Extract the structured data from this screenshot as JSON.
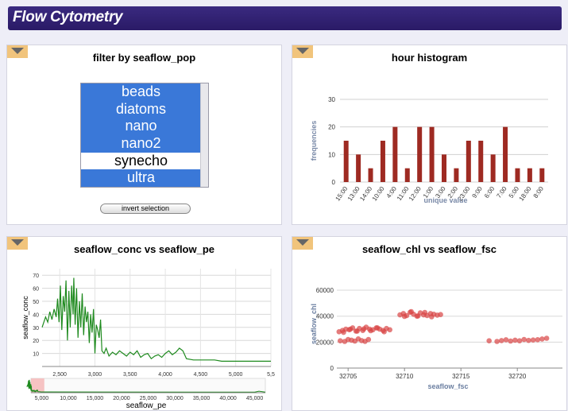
{
  "app": {
    "title": "Flow Cytometry"
  },
  "filter_panel": {
    "title": "filter by seaflow_pop",
    "options": [
      {
        "label": "beads",
        "selected": true
      },
      {
        "label": "diatoms",
        "selected": true
      },
      {
        "label": "nano",
        "selected": true
      },
      {
        "label": "nano2",
        "selected": true
      },
      {
        "label": "synecho",
        "selected": false
      },
      {
        "label": "ultra",
        "selected": true
      }
    ],
    "invert_label": "invert selection",
    "selected_color": "#3a78d8"
  },
  "histogram_panel": {
    "title": "hour histogram"
  },
  "conc_panel": {
    "title": "seaflow_conc vs seaflow_pe"
  },
  "chl_panel": {
    "title": "seaflow_chl vs seaflow_fsc"
  },
  "icons": {
    "collapse": "triangle-down-icon"
  },
  "chart_data": [
    {
      "type": "bar",
      "title": "hour histogram",
      "xlabel": "unique value",
      "ylabel": "frequencies",
      "ylim": [
        0,
        30
      ],
      "yticks": [
        0,
        10,
        20,
        30
      ],
      "categories": [
        "15:00",
        "13:00",
        "14:00",
        "10:00",
        "4:00",
        "11:00",
        "12:00",
        "1:00",
        "3:00",
        "2:00",
        "23:00",
        "9:00",
        "6:00",
        "7:00",
        "5:00",
        "18:00",
        "8:00"
      ],
      "values": [
        15,
        10,
        5,
        15,
        20,
        5,
        20,
        20,
        10,
        5,
        15,
        15,
        10,
        20,
        5,
        5,
        5
      ],
      "color": "#9e2a22",
      "grid": true
    },
    {
      "type": "line",
      "title": "seaflow_conc vs seaflow_pe",
      "xlabel": "",
      "ylabel": "seaflow_conc",
      "xlim": [
        2250,
        5500
      ],
      "ylim": [
        0,
        75
      ],
      "xticks": [
        2500,
        3000,
        3500,
        4000,
        4500,
        5000,
        5500
      ],
      "xtick_labels": [
        "2,500",
        "3,000",
        "3,500",
        "4,000",
        "4,500",
        "5,000",
        "5,5"
      ],
      "yticks": [
        10,
        20,
        30,
        40,
        50,
        60,
        70
      ],
      "color": "#1e8a1e",
      "x": [
        2250,
        2300,
        2330,
        2360,
        2390,
        2420,
        2450,
        2470,
        2490,
        2510,
        2530,
        2550,
        2570,
        2590,
        2610,
        2630,
        2650,
        2670,
        2690,
        2700,
        2720,
        2740,
        2760,
        2780,
        2800,
        2820,
        2840,
        2860,
        2880,
        2900,
        2920,
        2940,
        2960,
        2980,
        3000,
        3020,
        3040,
        3060,
        3080,
        3100,
        3130,
        3160,
        3200,
        3250,
        3300,
        3350,
        3400,
        3450,
        3500,
        3550,
        3600,
        3650,
        3700,
        3750,
        3800,
        3850,
        3900,
        3950,
        4000,
        4050,
        4100,
        4150,
        4200,
        4250,
        4300,
        4400,
        4500,
        4600,
        4700,
        4800,
        5000,
        5200,
        5500
      ],
      "y": [
        30,
        38,
        34,
        42,
        36,
        44,
        38,
        52,
        34,
        62,
        28,
        54,
        42,
        66,
        20,
        58,
        30,
        62,
        40,
        68,
        32,
        60,
        22,
        50,
        30,
        56,
        24,
        46,
        34,
        42,
        18,
        40,
        26,
        44,
        10,
        32,
        28,
        22,
        36,
        12,
        10,
        14,
        8,
        11,
        9,
        12,
        10,
        8,
        11,
        9,
        12,
        7,
        9,
        10,
        6,
        8,
        9,
        7,
        10,
        12,
        9,
        11,
        14,
        12,
        6,
        5,
        5,
        5,
        5,
        4,
        4,
        4,
        4
      ],
      "navigator": {
        "xticks": [
          5000,
          10000,
          15000,
          20000,
          25000,
          30000,
          35000,
          40000,
          45000
        ],
        "xtick_labels": [
          "5,000",
          "10,000",
          "15,000",
          "20,000",
          "25,000",
          "30,000",
          "35,000",
          "40,000",
          "45,000"
        ],
        "xlabel": "seaflow_pe",
        "xlim": [
          3000,
          47000
        ],
        "selection": [
          3000,
          5500
        ]
      },
      "grid": true
    },
    {
      "type": "scatter",
      "title": "seaflow_chl vs seaflow_fsc",
      "xlabel": "seaflow_fsc",
      "ylabel": "seaflow_chl",
      "xlim": [
        32704,
        32724
      ],
      "ylim": [
        0,
        68000
      ],
      "xticks": [
        32705,
        32710,
        32715,
        32720
      ],
      "yticks": [
        0,
        20000,
        40000,
        60000
      ],
      "color": "#d94545",
      "x": [
        32704.2,
        32704.5,
        32704.8,
        32705.1,
        32705.4,
        32705.7,
        32706.0,
        32706.3,
        32706.6,
        32706.9,
        32707.2,
        32707.5,
        32707.8,
        32708.1,
        32708.4,
        32708.7,
        32704.3,
        32704.7,
        32705.0,
        32705.3,
        32705.6,
        32705.9,
        32706.2,
        32706.5,
        32706.8,
        32704.6,
        32705.2,
        32705.8,
        32706.4,
        32707.0,
        32707.6,
        32708.2,
        32709.6,
        32709.9,
        32710.2,
        32710.5,
        32710.8,
        32711.1,
        32711.4,
        32711.7,
        32712.0,
        32712.3,
        32712.6,
        32712.9,
        32713.2,
        32710.0,
        32710.6,
        32711.2,
        32711.8,
        32712.4,
        32717.5,
        32718.2,
        32718.6,
        32719.0,
        32719.4,
        32719.8,
        32720.2,
        32720.6,
        32721.0,
        32721.4,
        32721.8,
        32722.2,
        32722.6
      ],
      "y": [
        28000,
        29000,
        30000,
        29500,
        31000,
        28500,
        30500,
        29000,
        31500,
        30000,
        29500,
        31000,
        30000,
        29000,
        30500,
        29500,
        21000,
        20500,
        22000,
        21500,
        20800,
        22500,
        21200,
        20600,
        22000,
        27500,
        30000,
        28500,
        30200,
        28800,
        31000,
        28000,
        41000,
        42000,
        40500,
        43000,
        41500,
        40000,
        42500,
        41000,
        40500,
        42000,
        41500,
        40800,
        41200,
        39800,
        43500,
        40200,
        42800,
        39500,
        21000,
        20500,
        21200,
        21800,
        20800,
        21500,
        21000,
        22000,
        21300,
        21600,
        21900,
        22400,
        23000
      ],
      "grid": true
    }
  ]
}
